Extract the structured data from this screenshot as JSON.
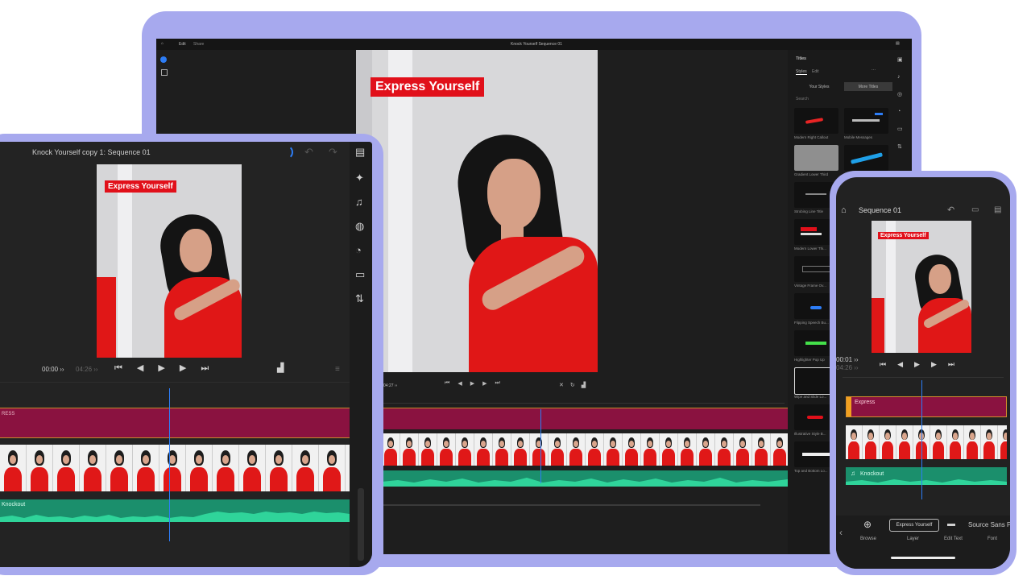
{
  "laptop": {
    "topbar": {
      "tab_edit": "Edit",
      "tab_share": "Share",
      "sequence_title": "Knock Yourself Sequence 01"
    },
    "canvas_title": "Express Yourself",
    "timecode": "04:27 ››",
    "panel": {
      "title": "Titles",
      "tab_styles": "Styles",
      "tab_edit": "Edit",
      "btn_your_styles": "Your Styles",
      "btn_more_titles": "More Titles",
      "search_placeholder": "Search",
      "templates": [
        {
          "label": "Modern Right Callout"
        },
        {
          "label": "Mobile Messages"
        },
        {
          "label": "Gradient Lower Third"
        },
        {
          "label": ""
        },
        {
          "label": "Strobing Line Title"
        },
        {
          "label": "Modern Lower Thi..."
        },
        {
          "label": "Vintage Frame Ov..."
        },
        {
          "label": "Flipping Speech Bu..."
        },
        {
          "label": "Highlighter Pop Up"
        },
        {
          "label": "Wipe and Slide Lo..."
        },
        {
          "label": "Illustrative Style B..."
        },
        {
          "label": "Top and Bottom Lo..."
        }
      ]
    }
  },
  "tablet": {
    "title": "Knock Yourself copy 1: Sequence 01",
    "canvas_title": "Express Yourself",
    "timecode_current": "00:00 ››",
    "timecode_total": "04:26 ››",
    "title_clip": "RESS",
    "audio_clip": "Knockout"
  },
  "phone": {
    "title": "Sequence 01",
    "canvas_title": "Express Yourself",
    "timecode_current": "00:01 ››",
    "timecode_total": "04:26 ››",
    "title_clip": "Express",
    "audio_clip": "Knockout",
    "toolbar": {
      "browse_label": "Browse",
      "layer_chip": "Express Yourself",
      "layer_label": "Layer",
      "edit_text_label": "Edit Text",
      "font_value": "Source Sans P",
      "font_label": "Font"
    }
  },
  "colors": {
    "device_frame": "#a7a9ee",
    "title_track": "#8a1240",
    "audio_track": "#1b8f6c",
    "accent_blue": "#2d7df6",
    "title_red": "#e1101a"
  },
  "icons": [
    "home-icon",
    "undo-icon",
    "redo-icon",
    "comment-icon",
    "play-icon",
    "pause-icon",
    "step-back-icon",
    "step-forward-icon",
    "skip-start-icon",
    "skip-end-icon",
    "music-icon",
    "plus-icon",
    "chevron-left-icon",
    "spinner-icon"
  ]
}
